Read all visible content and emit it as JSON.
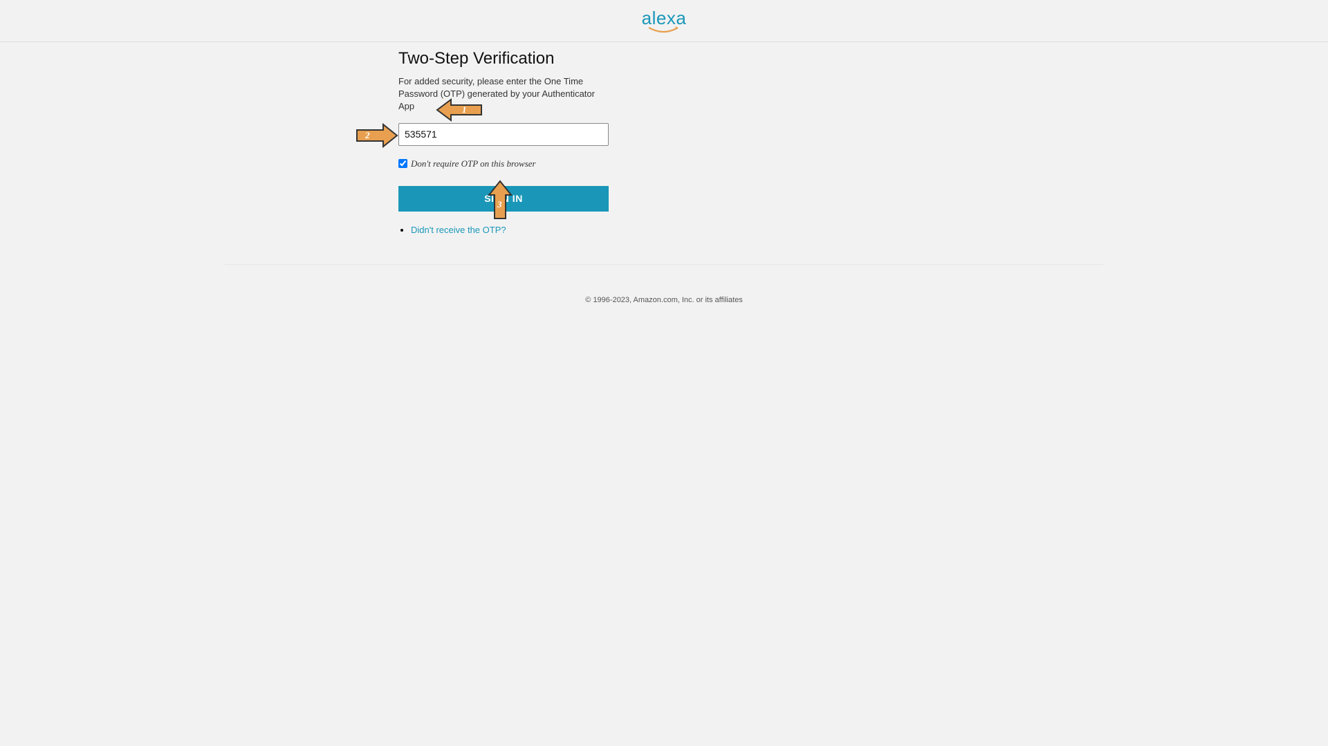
{
  "header": {
    "logo_text": "alexa"
  },
  "form": {
    "title": "Two-Step Verification",
    "description": "For added security, please enter the One Time Password (OTP) generated by your Authenticator App",
    "otp_value": "535571",
    "checkbox_label": "Don't require OTP on this browser",
    "checkbox_checked": true,
    "signin_button": "SIGN IN",
    "help_link": "Didn't receive the OTP?"
  },
  "footer": {
    "copyright": "© 1996-2023, Amazon.com, Inc. or its affiliates"
  },
  "annotations": {
    "arrow1": "1",
    "arrow2": "2",
    "arrow3": "3"
  }
}
